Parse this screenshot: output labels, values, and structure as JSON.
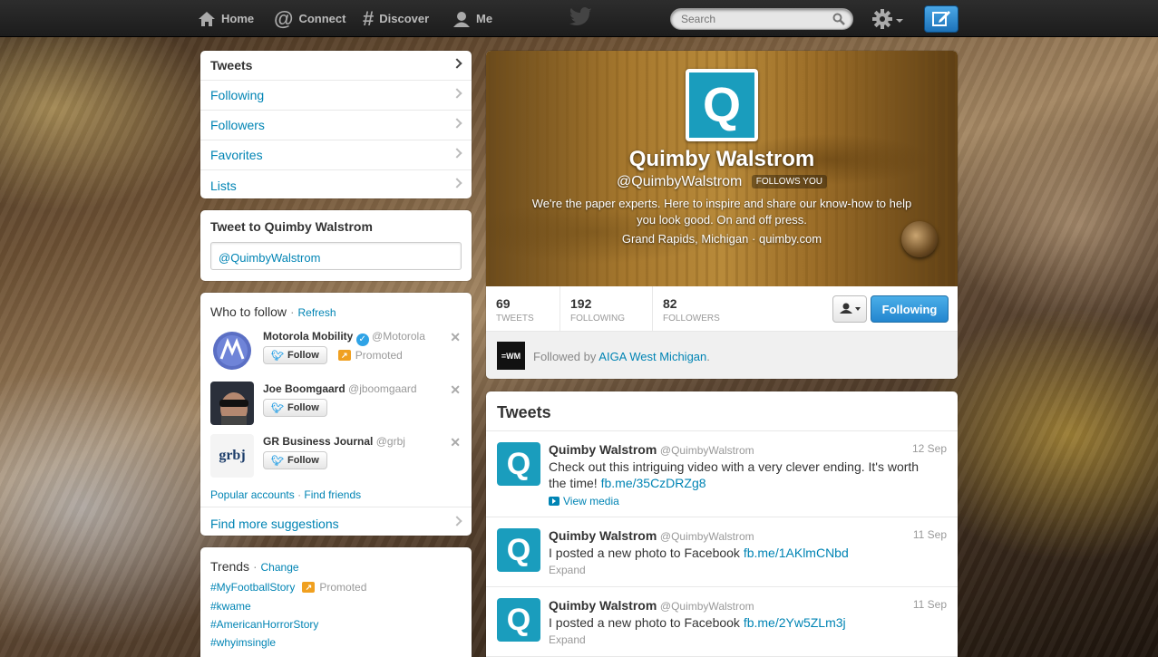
{
  "topbar": {
    "home": "Home",
    "connect": "Connect",
    "discover": "Discover",
    "me": "Me",
    "search_placeholder": "Search"
  },
  "sidenav": {
    "items": [
      {
        "label": "Tweets"
      },
      {
        "label": "Following"
      },
      {
        "label": "Followers"
      },
      {
        "label": "Favorites"
      },
      {
        "label": "Lists"
      }
    ]
  },
  "tweet_to": {
    "title": "Tweet to Quimby Walstrom",
    "value": "@QuimbyWalstrom"
  },
  "who_to_follow": {
    "title": "Who to follow",
    "sep": "·",
    "refresh": "Refresh",
    "suggestions": [
      {
        "name": "Motorola Mobility",
        "handle": "@Motorola",
        "follow": "Follow",
        "promoted": "Promoted"
      },
      {
        "name": "Joe Boomgaard",
        "handle": "@jboomgaard",
        "follow": "Follow"
      },
      {
        "name": "GR Business Journal",
        "handle": "@grbj",
        "follow": "Follow"
      }
    ],
    "popular": "Popular accounts",
    "sep2": "·",
    "find_friends": "Find friends",
    "find_more": "Find more suggestions"
  },
  "trends": {
    "title": "Trends",
    "sep": "·",
    "change": "Change",
    "promoted": "Promoted",
    "items": [
      "#MyFootballStory",
      "#kwame",
      "#AmericanHorrorStory",
      "#whyimsingle"
    ]
  },
  "profile": {
    "avatar_letter": "Q",
    "name": "Quimby Walstrom",
    "handle": "@QuimbyWalstrom",
    "follows_you": "FOLLOWS YOU",
    "bio": "We're the paper experts. Here to inspire and share our know-how to help you look good. On and off press.",
    "location": "Grand Rapids, Michigan",
    "dot": "·",
    "url": "quimby.com",
    "stats": [
      {
        "count": "69",
        "label": "TWEETS"
      },
      {
        "count": "192",
        "label": "FOLLOWING"
      },
      {
        "count": "82",
        "label": "FOLLOWERS"
      }
    ],
    "following_btn": "Following",
    "followed_by_prefix": "Followed by",
    "followed_by_link": "AIGA West Michigan",
    "followed_by_suffix": ".",
    "aiga_logo": "=WM"
  },
  "tweets": {
    "title": "Tweets",
    "items": [
      {
        "name": "Quimby Walstrom",
        "handle": "@QuimbyWalstrom",
        "date": "12 Sep",
        "text": "Check out this intriguing video with a very clever ending.  It's worth the time!",
        "link": "fb.me/35CzDRZg8",
        "action": "View media"
      },
      {
        "name": "Quimby Walstrom",
        "handle": "@QuimbyWalstrom",
        "date": "11 Sep",
        "text": "I posted a new photo to Facebook",
        "link": "fb.me/1AKlmCNbd",
        "action": "Expand"
      },
      {
        "name": "Quimby Walstrom",
        "handle": "@QuimbyWalstrom",
        "date": "11 Sep",
        "text": "I posted a new photo to Facebook",
        "link": "fb.me/2Yw5ZLm3j",
        "action": "Expand"
      }
    ]
  },
  "colors": {
    "link": "#0084b4",
    "accent": "#1a9dbd",
    "follow_btn": "#2f8fd6",
    "topbar": "#222222"
  }
}
